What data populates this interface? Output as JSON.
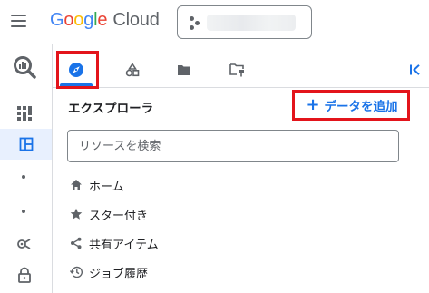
{
  "header": {
    "logo": {
      "g1": "G",
      "g2": "o",
      "g3": "o",
      "g4": "g",
      "g5": "l",
      "g6": "e",
      "product": "Cloud"
    }
  },
  "explorer": {
    "title": "エクスプローラ",
    "add_data": {
      "icon": "+",
      "label": "データを追加"
    },
    "search_placeholder": "リソースを検索",
    "items": [
      {
        "icon": "home-icon",
        "label": "ホーム"
      },
      {
        "icon": "star-icon",
        "label": "スター付き"
      },
      {
        "icon": "share-icon",
        "label": "共有アイテム"
      },
      {
        "icon": "history-icon",
        "label": "ジョブ履歴"
      }
    ]
  },
  "colors": {
    "accent": "#1a73e8",
    "highlight_box": "#e3141b",
    "icon": "#5f6368",
    "active_bg": "#e8f0fe"
  }
}
